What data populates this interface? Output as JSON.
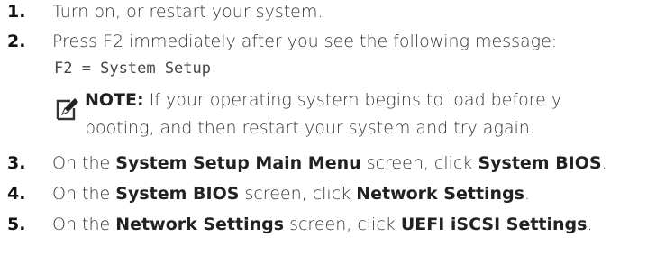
{
  "steps": [
    {
      "number": "1.",
      "parts": [
        "Turn on, or restart your system."
      ]
    },
    {
      "number": "2.",
      "parts": [
        "Press F2 immediately after you see the following message:"
      ]
    },
    {
      "number": "3.",
      "parts": [
        "On the ",
        "System Setup Main Menu",
        " screen, click ",
        "System BIOS",
        "."
      ]
    },
    {
      "number": "4.",
      "parts": [
        "On the ",
        "System BIOS",
        " screen, click ",
        "Network Settings",
        "."
      ]
    },
    {
      "number": "5.",
      "parts": [
        "On the ",
        "Network Settings",
        " screen, click ",
        "UEFI iSCSI Settings",
        "."
      ]
    }
  ],
  "code_message": "F2 = System Setup",
  "note": {
    "icon": "pencil-note-icon",
    "label": "NOTE:",
    "line1_rest": " If your operating system begins to load before y",
    "line2": "booting, and then restart your system and try again."
  }
}
